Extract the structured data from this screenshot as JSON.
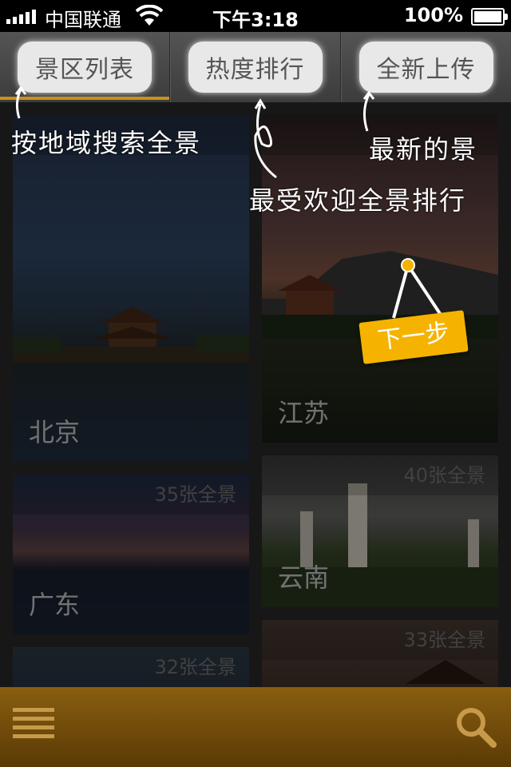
{
  "status_bar": {
    "carrier": "中国联通",
    "time": "下午3:18",
    "battery": "100%"
  },
  "tabs": [
    {
      "label": "景区列表"
    },
    {
      "label": "热度排行"
    },
    {
      "label": "全新上传"
    }
  ],
  "hints": {
    "region": "按地域搜索全景",
    "newest": "最新的景",
    "popular": "最受欢迎全景排行",
    "next": "下一步"
  },
  "cards": [
    {
      "city": "北京",
      "count": ""
    },
    {
      "city": "江苏",
      "count": ""
    },
    {
      "city": "广东",
      "count": "35张全景"
    },
    {
      "city": "云南",
      "count": "40张全景"
    },
    {
      "city": "",
      "count": "32张全景"
    },
    {
      "city": "",
      "count": "33张全景"
    }
  ],
  "icons": {
    "menu": "menu-icon",
    "search": "search-icon"
  },
  "colors": {
    "accent": "#f5b300",
    "tab_indicator": "#c8901c",
    "bottom_bar": "#7a520c"
  }
}
